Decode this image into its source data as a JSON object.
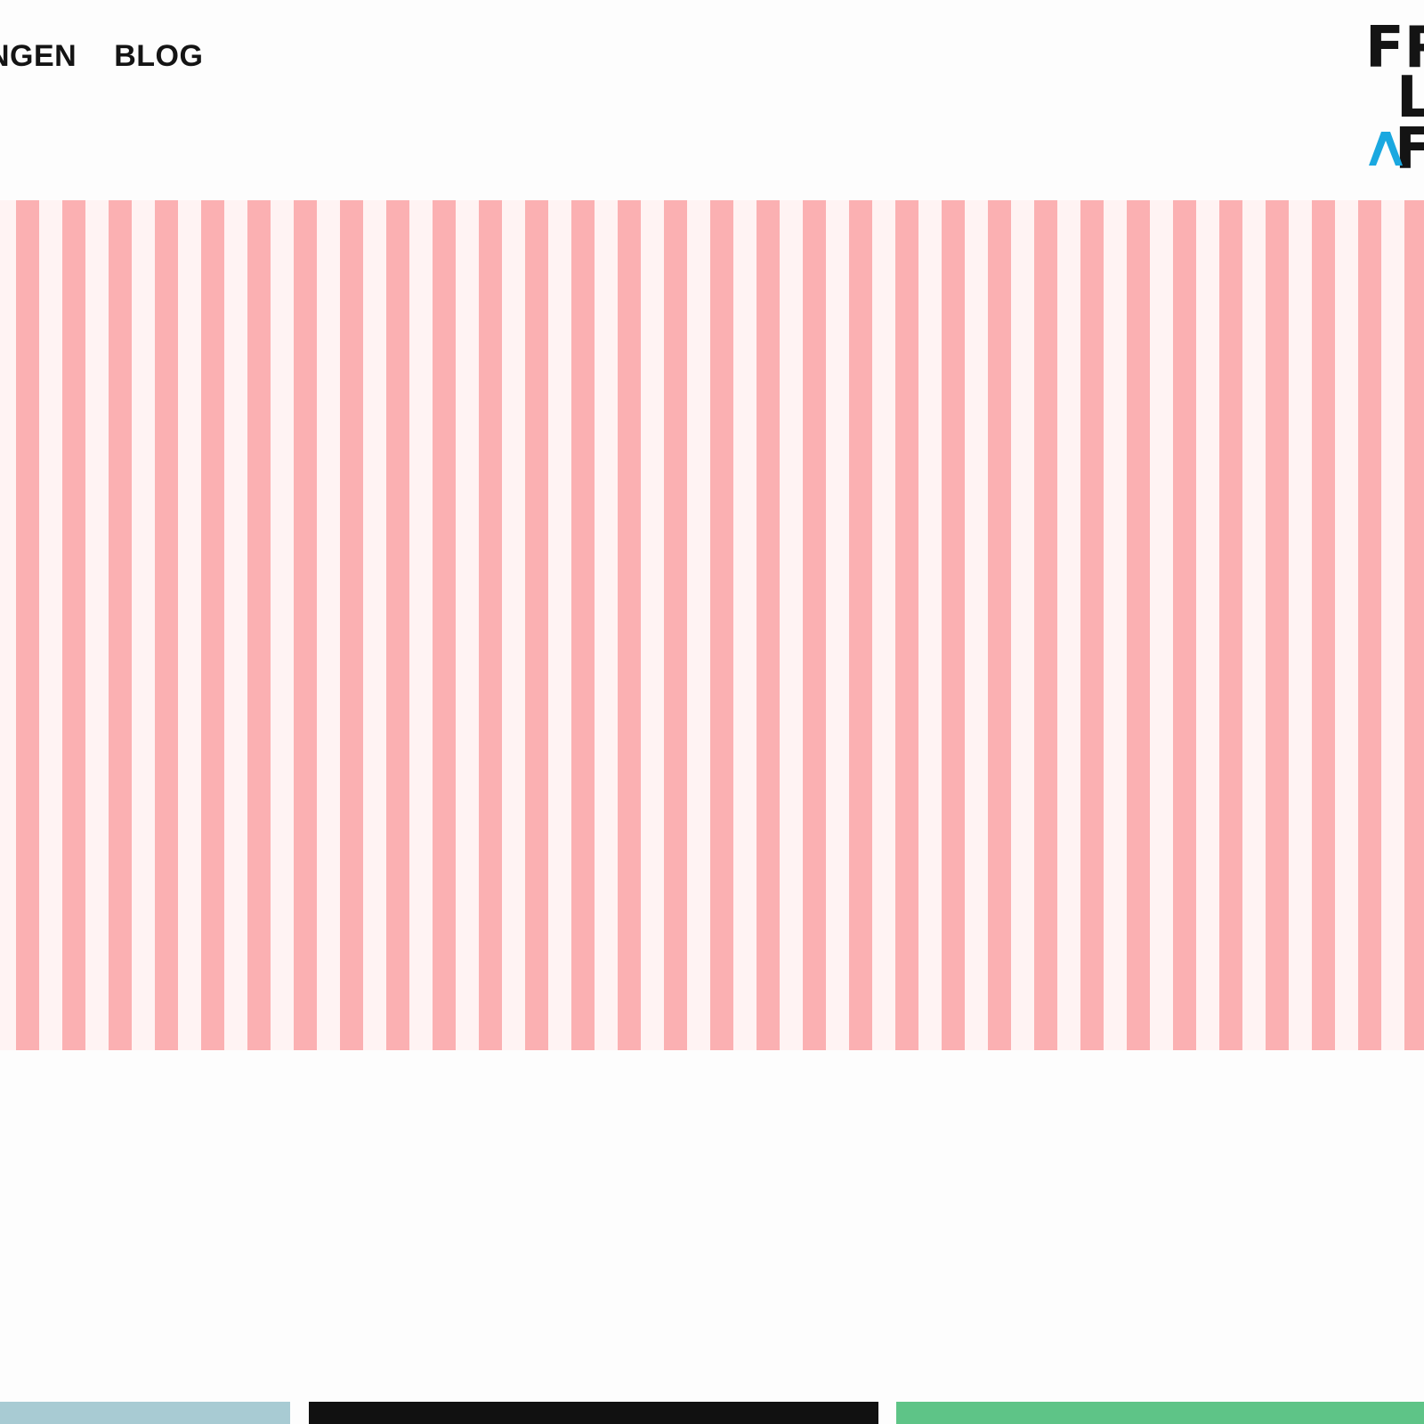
{
  "nav": {
    "items": [
      {
        "label": "NGEN"
      },
      {
        "label": "BLOG"
      }
    ]
  },
  "logo": {
    "line1": "FR",
    "line2": "L",
    "line3": "F",
    "accent_icon": "caret-up-icon",
    "accent_color": "#1aa8e0"
  },
  "hero": {
    "stripe_colors": [
      "#fbb0b2",
      "#fff3f3"
    ]
  },
  "cards": [
    {
      "name": "card-blue",
      "color": "#a8cbd3"
    },
    {
      "name": "card-black",
      "color": "#111111"
    },
    {
      "name": "card-green",
      "color": "#5ec487"
    }
  ]
}
